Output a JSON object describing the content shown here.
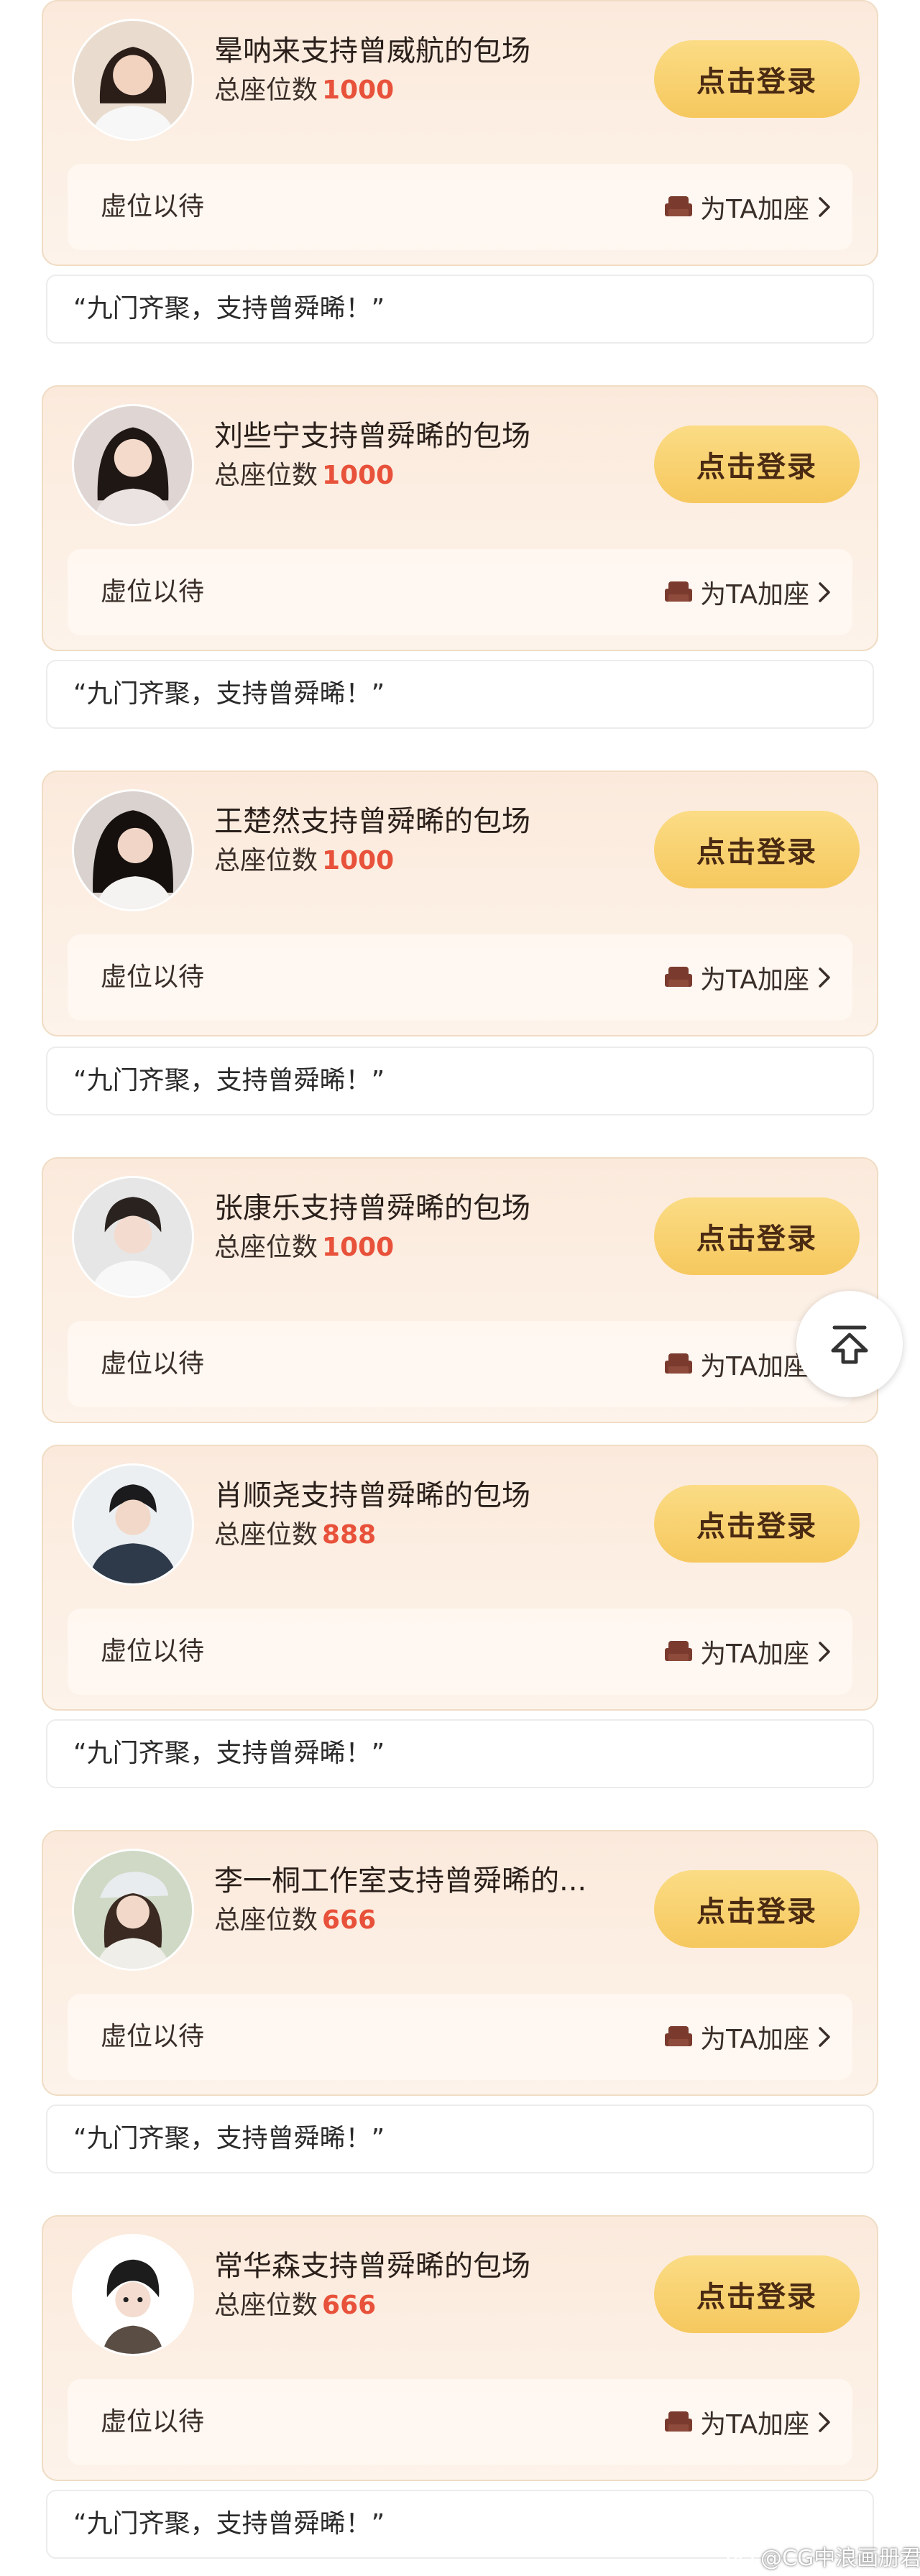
{
  "cards": [
    {
      "title": "晕呐来支持曾威航的包场",
      "seats_label": "总座位数",
      "seats": "1000",
      "login": "点击登录",
      "vacant": "虚位以待",
      "add_seat": "为TA加座",
      "message": "“九门齐聚，支持曾舜晞！”"
    },
    {
      "title": "刘些宁支持曾舜晞的包场",
      "seats_label": "总座位数",
      "seats": "1000",
      "login": "点击登录",
      "vacant": "虚位以待",
      "add_seat": "为TA加座",
      "message": "“九门齐聚，支持曾舜晞！”"
    },
    {
      "title": "王楚然支持曾舜晞的包场",
      "seats_label": "总座位数",
      "seats": "1000",
      "login": "点击登录",
      "vacant": "虚位以待",
      "add_seat": "为TA加座",
      "message": "“九门齐聚，支持曾舜晞！”"
    },
    {
      "title": "张康乐支持曾舜晞的包场",
      "seats_label": "总座位数",
      "seats": "1000",
      "login": "点击登录",
      "vacant": "虚位以待",
      "add_seat": "为TA加座",
      "message": ""
    },
    {
      "title": "肖顺尧支持曾舜晞的包场",
      "seats_label": "总座位数",
      "seats": "888",
      "login": "点击登录",
      "vacant": "虚位以待",
      "add_seat": "为TA加座",
      "message": "“九门齐聚，支持曾舜晞！”"
    },
    {
      "title": "李一桐工作室支持曾舜晞的...",
      "seats_label": "总座位数",
      "seats": "666",
      "login": "点击登录",
      "vacant": "虚位以待",
      "add_seat": "为TA加座",
      "message": "“九门齐聚，支持曾舜晞！”"
    },
    {
      "title": "常华森支持曾舜晞的包场",
      "seats_label": "总座位数",
      "seats": "666",
      "login": "点击登录",
      "vacant": "虚位以待",
      "add_seat": "为TA加座",
      "message": "“九门齐聚，支持曾舜晞！”"
    }
  ],
  "watermark": "@CG中浪画册君",
  "icons": {
    "add_seat": "sofa-icon",
    "chevron": "chevron-right-icon",
    "scroll_top": "arrow-up-icon",
    "watermark": "weibo-logo-icon"
  },
  "colors": {
    "card_bg": "#fcefe4",
    "login_button": "#f6c85e",
    "seat_count": "#e8513a",
    "text": "#2a1f1a"
  }
}
